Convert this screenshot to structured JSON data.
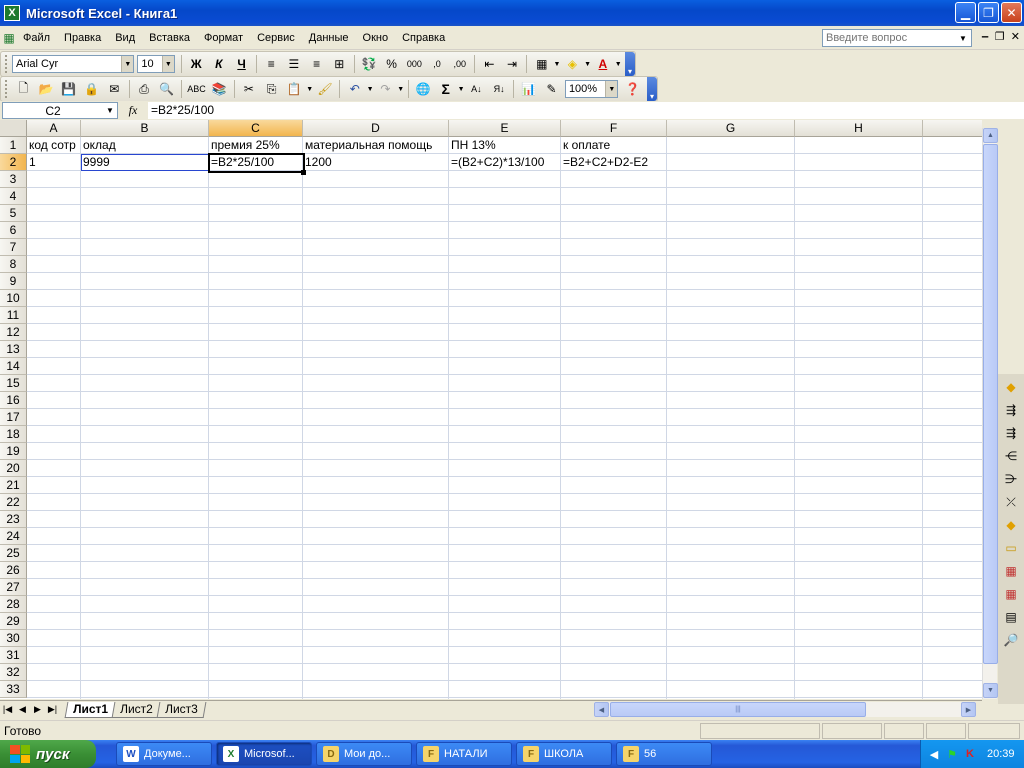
{
  "window": {
    "title": "Microsoft Excel - Книга1",
    "app_icon_letter": "X"
  },
  "menu": {
    "items": [
      "Файл",
      "Правка",
      "Вид",
      "Вставка",
      "Формат",
      "Сервис",
      "Данные",
      "Окно",
      "Справка"
    ],
    "help_placeholder": "Введите вопрос"
  },
  "format_toolbar": {
    "font": "Arial Cyr",
    "size": "10",
    "bold": "Ж",
    "italic": "К",
    "underline": "Ч"
  },
  "standard_toolbar": {
    "zoom": "100%",
    "sigma": "Σ"
  },
  "formula_bar": {
    "name_box": "C2",
    "fx": "fx",
    "formula": "=B2*25/100"
  },
  "sheet": {
    "columns": [
      "A",
      "B",
      "C",
      "D",
      "E",
      "F",
      "G",
      "H"
    ],
    "active_column": "C",
    "active_row": "2",
    "rows": [
      "1",
      "2",
      "3",
      "4",
      "5",
      "6",
      "7",
      "8",
      "9",
      "10",
      "11",
      "12",
      "13",
      "14",
      "15",
      "16",
      "17",
      "18",
      "19",
      "20",
      "21",
      "22",
      "23",
      "24",
      "25",
      "26",
      "27",
      "28",
      "29",
      "30",
      "31",
      "32",
      "33"
    ],
    "row1": {
      "A": "код сотр",
      "B": "оклад",
      "C": "премия 25%",
      "D": "материальная помощь",
      "E": "ПН 13%",
      "F": "к оплате"
    },
    "row2": {
      "A": "1",
      "B": "9999",
      "C": "=B2*25/100",
      "D": "1200",
      "E": "=(B2+C2)*13/100",
      "F": "=B2+C2+D2-E2"
    }
  },
  "tabs": {
    "sheets": [
      "Лист1",
      "Лист2",
      "Лист3"
    ],
    "active": "Лист1"
  },
  "status": {
    "text": "Готово"
  },
  "taskbar": {
    "start": "пуск",
    "buttons": [
      {
        "label": "Докуме...",
        "icon": "W"
      },
      {
        "label": "Microsof...",
        "icon": "X"
      },
      {
        "label": "Мои до...",
        "icon": "D"
      },
      {
        "label": "НАТАЛИ",
        "icon": "F"
      },
      {
        "label": "ШКОЛА",
        "icon": "F"
      },
      {
        "label": "56",
        "icon": "F"
      }
    ],
    "clock": "20:39"
  },
  "colors": {
    "titlebar": "#0a5fe0",
    "active_header": "#f2b54e",
    "selection_border": "#000000",
    "copy_marquee": "#2846d0",
    "taskbar": "#2563e4",
    "start": "#3a8f35"
  }
}
